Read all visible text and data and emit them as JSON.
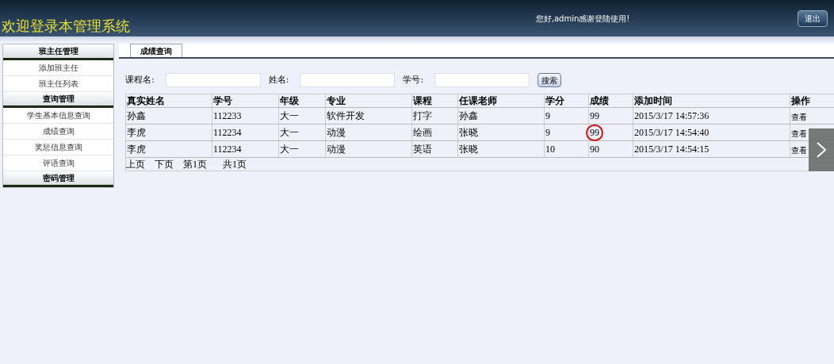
{
  "header": {
    "title": "欢迎登录本管理系统",
    "greeting": "您好,admin感谢登陆使用!",
    "logout": "退出"
  },
  "sidebar": [
    {
      "title": "班主任管理",
      "items": [
        "添加班主任",
        "班主任列表"
      ]
    },
    {
      "title": "查询管理",
      "items": [
        "学生基本信息查询",
        "成绩查询",
        "奖惩信息查询",
        "评语查询"
      ]
    },
    {
      "title": "密码管理"
    }
  ],
  "tabs": [
    {
      "label": "成绩查询",
      "selected": true
    }
  ],
  "search": {
    "fields": [
      {
        "label": "课程名:"
      },
      {
        "label": "姓名:"
      },
      {
        "label": "学号:"
      }
    ],
    "button": "搜索"
  },
  "table": {
    "columns": [
      "真实姓名",
      "学号",
      "年级",
      "专业",
      "课程",
      "任课老师",
      "学分",
      "成绩",
      "添加时间",
      "操作"
    ],
    "rows": [
      {
        "cells": [
          "孙鑫",
          "112233",
          "大一",
          "软件开发",
          "打字",
          "孙鑫",
          "9",
          "99",
          "2015/3/17 14:57:36"
        ],
        "action": "查看",
        "circled": false
      },
      {
        "cells": [
          "李虎",
          "112234",
          "大一",
          "动漫",
          "绘画",
          "张晓",
          "9",
          "99",
          "2015/3/17 14:54:40"
        ],
        "action": "查看",
        "circled": true
      },
      {
        "cells": [
          "李虎",
          "112234",
          "大一",
          "动漫",
          "英语",
          "张晓",
          "10",
          "90",
          "2015/3/17 14:54:15"
        ],
        "action": "查看",
        "circled": false
      }
    ]
  },
  "pager": [
    "上页",
    "下页",
    "第1页",
    "共1页"
  ]
}
